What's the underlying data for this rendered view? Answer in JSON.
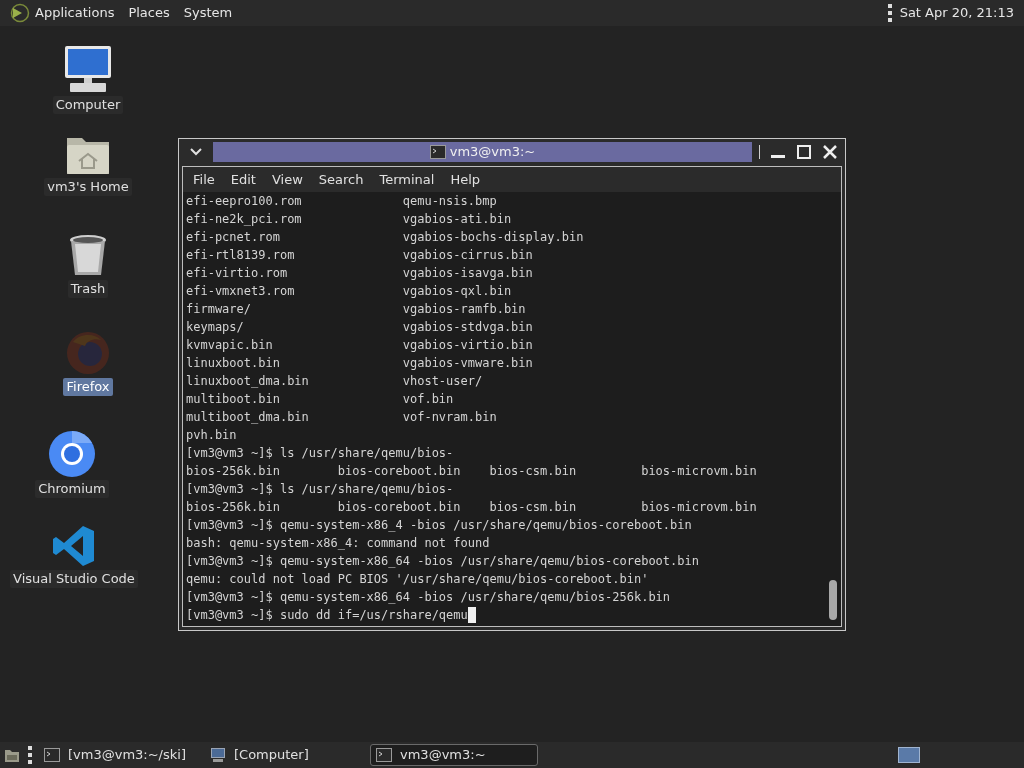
{
  "top_panel": {
    "menus": [
      "Applications",
      "Places",
      "System"
    ],
    "clock": "Sat Apr 20, 21:13"
  },
  "desktop_icons": [
    {
      "label": "Computer",
      "kind": "computer",
      "selected": false
    },
    {
      "label": "vm3's Home",
      "kind": "home",
      "selected": false
    },
    {
      "label": "Trash",
      "kind": "trash",
      "selected": false
    },
    {
      "label": "Firefox",
      "kind": "firefox",
      "selected": true
    },
    {
      "label": "Chromium",
      "kind": "chromium",
      "selected": false
    },
    {
      "label": "Visual Studio Code",
      "kind": "vscode",
      "selected": false
    }
  ],
  "terminal_window": {
    "title": "vm3@vm3:~",
    "menu": [
      "File",
      "Edit",
      "View",
      "Search",
      "Terminal",
      "Help"
    ],
    "lines": [
      "efi-eepro100.rom              qemu-nsis.bmp",
      "efi-ne2k_pci.rom              vgabios-ati.bin",
      "efi-pcnet.rom                 vgabios-bochs-display.bin",
      "efi-rtl8139.rom               vgabios-cirrus.bin",
      "efi-virtio.rom                vgabios-isavga.bin",
      "efi-vmxnet3.rom               vgabios-qxl.bin",
      "firmware/                     vgabios-ramfb.bin",
      "keymaps/                      vgabios-stdvga.bin",
      "kvmvapic.bin                  vgabios-virtio.bin",
      "linuxboot.bin                 vgabios-vmware.bin",
      "linuxboot_dma.bin             vhost-user/",
      "multiboot.bin                 vof.bin",
      "multiboot_dma.bin             vof-nvram.bin",
      "pvh.bin",
      "[vm3@vm3 ~]$ ls /usr/share/qemu/bios-",
      "bios-256k.bin        bios-coreboot.bin    bios-csm.bin         bios-microvm.bin",
      "[vm3@vm3 ~]$ ls /usr/share/qemu/bios-",
      "bios-256k.bin        bios-coreboot.bin    bios-csm.bin         bios-microvm.bin",
      "[vm3@vm3 ~]$ qemu-system-x86_4 -bios /usr/share/qemu/bios-coreboot.bin",
      "bash: qemu-system-x86_4: command not found",
      "[vm3@vm3 ~]$ qemu-system-x86_64 -bios /usr/share/qemu/bios-coreboot.bin",
      "qemu: could not load PC BIOS '/usr/share/qemu/bios-coreboot.bin'",
      "[vm3@vm3 ~]$ qemu-system-x86_64 -bios /usr/share/qemu/bios-256k.bin",
      "[vm3@vm3 ~]$ sudo dd if=/us/rshare/qemu"
    ]
  },
  "taskbar": {
    "tasks": [
      {
        "label": "[vm3@vm3:~/ski]",
        "kind": "terminal",
        "selected": false
      },
      {
        "label": "[Computer]",
        "kind": "computer",
        "selected": false
      },
      {
        "label": "vm3@vm3:~",
        "kind": "terminal",
        "selected": true
      }
    ],
    "workspaces": [
      {
        "selected": true
      }
    ]
  }
}
